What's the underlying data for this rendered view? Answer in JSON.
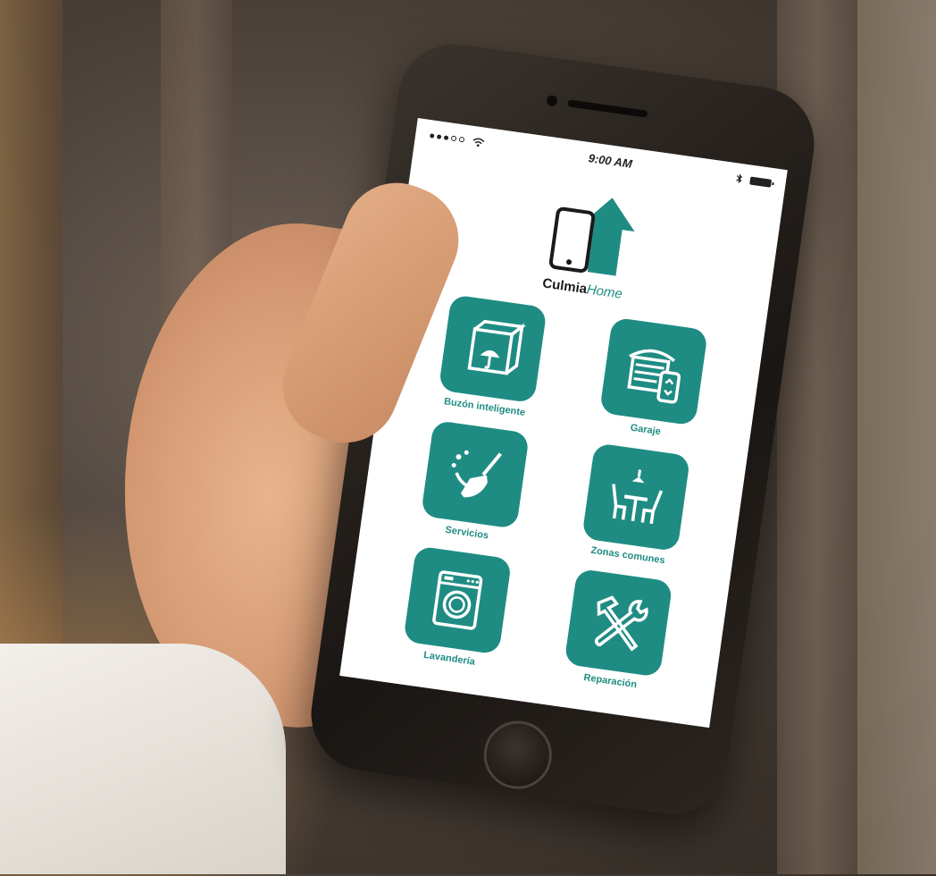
{
  "status_bar": {
    "time": "9:00 AM"
  },
  "brand": {
    "name_bold": "Culmia",
    "name_italic": "Home",
    "accent_color": "#1f8c83"
  },
  "menu": {
    "items": [
      {
        "label": "Buzón inteligente",
        "icon": "mailbox-box-icon"
      },
      {
        "label": "Garaje",
        "icon": "garage-remote-icon"
      },
      {
        "label": "Servicios",
        "icon": "cleaning-broom-icon"
      },
      {
        "label": "Zonas comunes",
        "icon": "common-area-table-icon"
      },
      {
        "label": "Lavandería",
        "icon": "washing-machine-icon"
      },
      {
        "label": "Reparación",
        "icon": "tools-repair-icon"
      }
    ]
  }
}
